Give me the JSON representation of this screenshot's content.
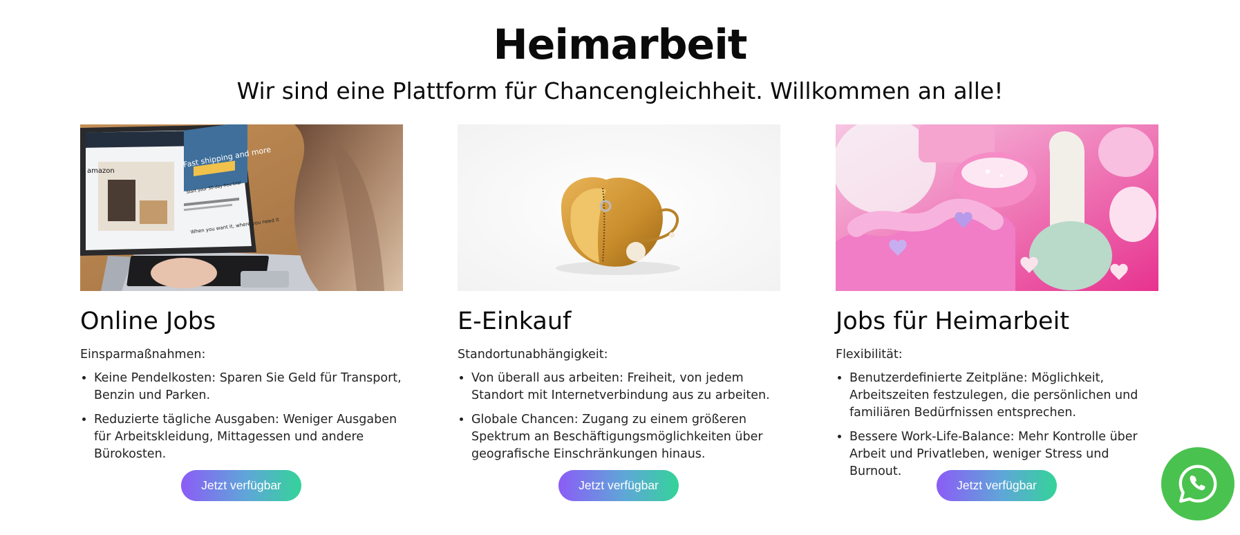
{
  "header": {
    "title": "Heimarbeit",
    "subtitle": "Wir sind eine Plattform für Chancengleichheit. Willkommen an alle!"
  },
  "cards": [
    {
      "title": "Online Jobs",
      "intro": "Einsparmaßnahmen:",
      "bullets": [
        "Keine Pendelkosten: Sparen Sie Geld für Transport, Benzin und Parken.",
        "Reduzierte tägliche Ausgaben: Weniger Ausgaben für Arbeitskleidung, Mittagessen und andere Bürokosten."
      ],
      "button": "Jetzt verfügbar",
      "laptop_screen": {
        "brand": "amazon",
        "headline": "Fast shipping and more",
        "cta": "Start your 30-day free trial",
        "tagline": "When you want it, where you need it"
      }
    },
    {
      "title": "E-Einkauf",
      "intro": "Standortunabhängigkeit:",
      "bullets": [
        "Von überall aus arbeiten: Freiheit, von jedem Standort mit Internetverbindung aus zu arbeiten.",
        "Globale Chancen: Zugang zu einem größeren Spektrum an Beschäftigungsmöglichkeiten über geografische Einschränkungen hinaus."
      ],
      "button": "Jetzt verfügbar"
    },
    {
      "title": "Jobs für Heimarbeit",
      "intro": "Flexibilität:",
      "bullets": [
        "Benutzerdefinierte Zeitpläne: Möglichkeit, Arbeitszeiten festzulegen, die persönlichen und familiären Bedürfnissen entsprechen.",
        "Bessere Work-Life-Balance: Mehr Kontrolle über Arbeit und Privatleben, weniger Stress und Burnout."
      ],
      "button": "Jetzt verfügbar"
    }
  ],
  "colors": {
    "button_gradient_start": "#8b5cf6",
    "button_gradient_end": "#34d399",
    "whatsapp_green": "#4ac24f"
  },
  "icons": {
    "floating": "whatsapp-icon"
  }
}
